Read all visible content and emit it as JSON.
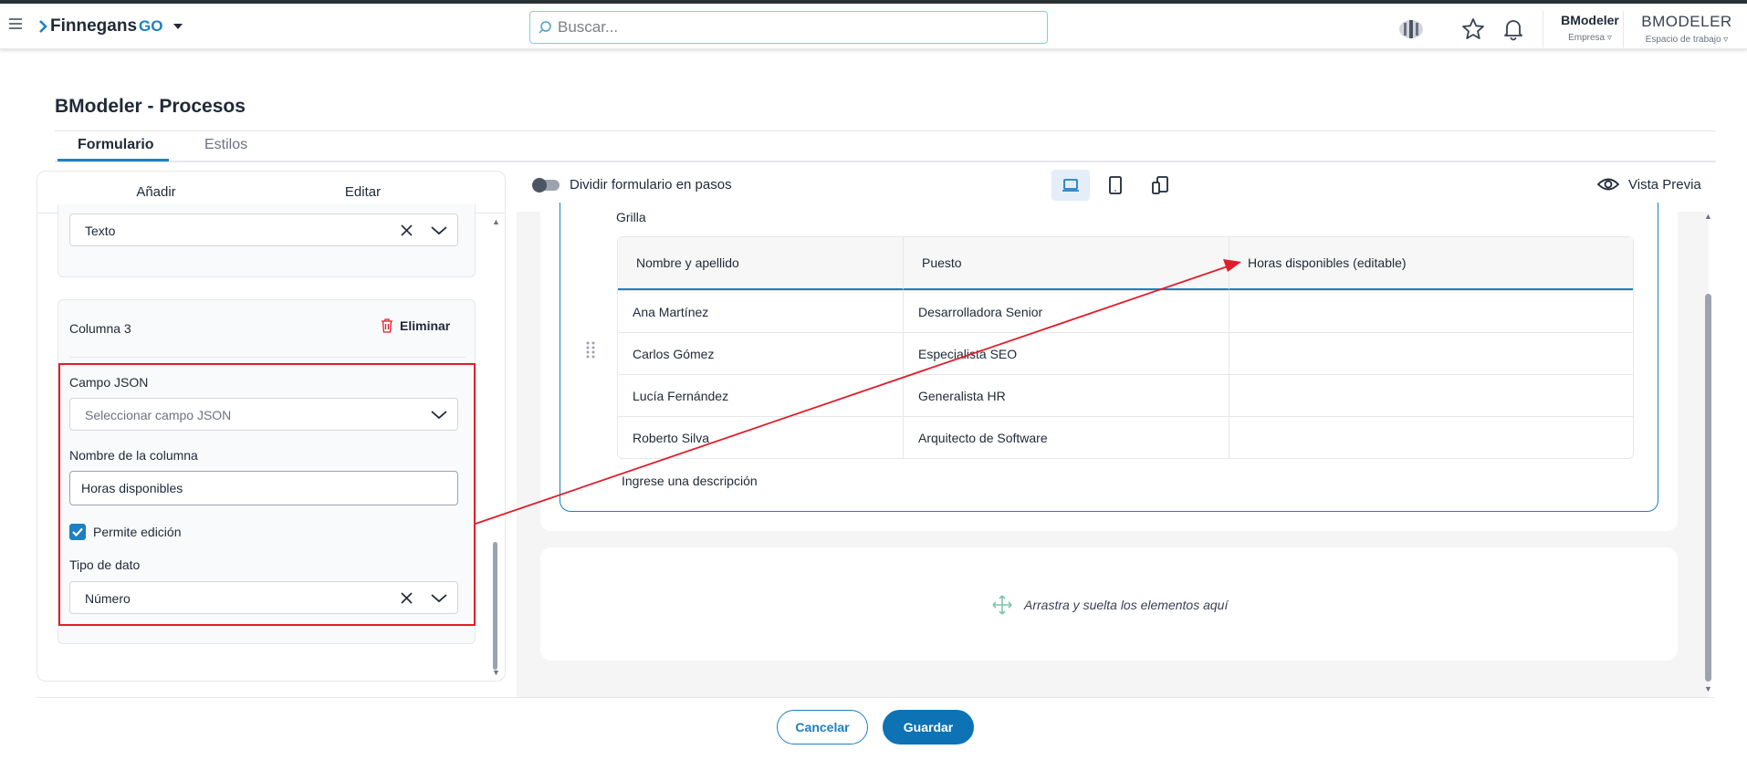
{
  "app": {
    "logo_text": "Finnegans",
    "logo_suffix": "GO",
    "search_placeholder": "Buscar...",
    "company": {
      "name": "BModeler",
      "label": "Empresa"
    },
    "workspace": {
      "name": "BMODELER",
      "label": "Espacio de trabajo"
    }
  },
  "page": {
    "title": "BModeler - Procesos",
    "tabs": [
      {
        "label": "Formulario",
        "active": true
      },
      {
        "label": "Estilos",
        "active": false
      }
    ]
  },
  "left_panel": {
    "tabs": [
      {
        "label": "Añadir",
        "active": false
      },
      {
        "label": "Editar",
        "active": true
      }
    ],
    "prev_column_type": "Texto",
    "column": {
      "title": "Columna 3",
      "delete_label": "Eliminar",
      "json_field_label": "Campo JSON",
      "json_field_placeholder": "Seleccionar campo JSON",
      "name_label": "Nombre de la columna",
      "name_value": "Horas disponibles",
      "editable_label": "Permite edición",
      "editable_checked": true,
      "type_label": "Tipo de dato",
      "type_value": "Número"
    }
  },
  "workspace": {
    "split_steps_label": "Dividir formulario en pasos",
    "split_steps_on": false,
    "devices": [
      "laptop-icon",
      "tablet-icon",
      "mobile-icon"
    ],
    "preview_label": "Vista Previa",
    "grid": {
      "title": "Grilla",
      "columns": [
        "Nombre y apellido",
        "Puesto",
        "Horas disponibles  (editable)"
      ],
      "rows": [
        [
          "Ana Martínez",
          "Desarrolladora Senior",
          ""
        ],
        [
          "Carlos Gómez",
          "Especialista SEO",
          ""
        ],
        [
          "Lucía Fernández",
          "Generalista HR",
          ""
        ],
        [
          "Roberto Silva",
          "Arquitecto de Software",
          ""
        ]
      ],
      "description_placeholder": "Ingrese una descripción"
    },
    "dropzone_text": "Arrastra y suelta los elementos aquí"
  },
  "footer": {
    "cancel_label": "Cancelar",
    "save_label": "Guardar"
  },
  "colors": {
    "accent": "#1e7fc2",
    "primary_button": "#0d73b5",
    "annotation": "#e11d2a"
  }
}
